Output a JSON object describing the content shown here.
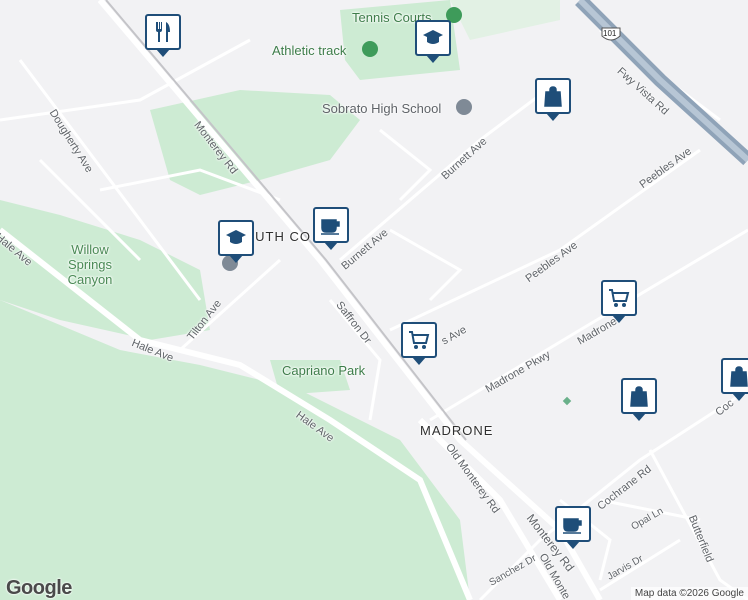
{
  "map": {
    "google_logo": "Google",
    "attribution": "Map data ©2026 Google",
    "colors": {
      "land": "#f2f2f4",
      "park": "#cdebd3",
      "road": "#ffffff",
      "highway": "#8fa3b8",
      "pin_border": "#1f4e79",
      "poi_green": "#3e7d4a"
    },
    "streets": {
      "dougherty": "Dougherty Ave",
      "monterey_upper": "Monterey Rd",
      "burnett_upper": "Burnett Ave",
      "burnett_lower": "Burnett Ave",
      "peebles_upper": "Peebles Ave",
      "peebles_lower": "Peebles Ave",
      "fwy_vista": "Fwy Vista Rd",
      "hale_left": "Hale Ave",
      "hale_mid": "Hale Ave",
      "hale_lower": "Hale Ave",
      "tilton": "Tilton Ave",
      "saffron": "Saffron Dr",
      "madrone_pkwy": "Madrone Pkwy",
      "madrone_right": "Madrone",
      "partial_s_ave": "s Ave",
      "old_monterey": "Old Monterey Rd",
      "old_monte_lower": "Old Monte",
      "monterey_lower": "Monterey Rd",
      "cochrane": "Cochrane Rd",
      "cochrane_partial": "Coc",
      "sanchez": "Sanchez Dr",
      "jarvis": "Jarvis Dr",
      "opal": "Opal Ln",
      "butterfield": "Butterfield"
    },
    "highway_shield": "101",
    "places": {
      "tennis": "Tennis Courts",
      "athletic": "Athletic track",
      "sobrato": "Sobrato High School",
      "south_co": "OUTH CO",
      "willow": "Willow Springs Canyon",
      "capriano": "Capriano Park",
      "madrone_area": "MADRONE"
    },
    "pins": [
      {
        "name": "restaurant",
        "icon": "fork-knife-icon"
      },
      {
        "name": "school-top",
        "icon": "graduation-cap-icon"
      },
      {
        "name": "shopping-bag-top",
        "icon": "shopping-bag-icon"
      },
      {
        "name": "cafe-mid",
        "icon": "coffee-cup-icon"
      },
      {
        "name": "school-mid",
        "icon": "graduation-cap-icon"
      },
      {
        "name": "grocery-center",
        "icon": "shopping-cart-icon"
      },
      {
        "name": "grocery-right",
        "icon": "shopping-cart-icon"
      },
      {
        "name": "shopping-bag-right",
        "icon": "shopping-bag-icon"
      },
      {
        "name": "shopping-bag-edge",
        "icon": "shopping-bag-icon"
      },
      {
        "name": "cafe-bottom",
        "icon": "coffee-cup-icon"
      }
    ]
  }
}
